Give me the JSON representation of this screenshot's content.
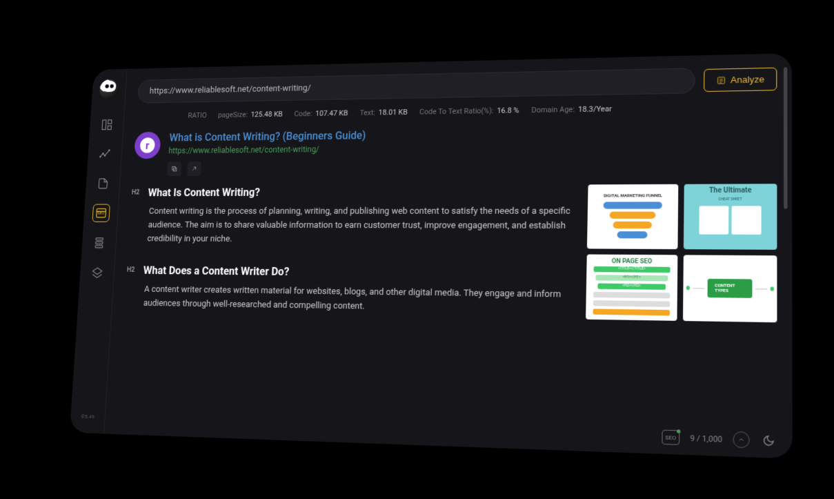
{
  "sidebar": {
    "version": "©5.49",
    "items": [
      {
        "name": "dashboard-icon"
      },
      {
        "name": "analytics-icon"
      },
      {
        "name": "pages-icon"
      },
      {
        "name": "seo-icon",
        "active": true,
        "label": "SEO"
      },
      {
        "name": "layers-icon"
      },
      {
        "name": "shape-icon"
      }
    ]
  },
  "header": {
    "url_value": "https://www.reliablesoft.net/content-writing/",
    "analyze_label": "Analyze"
  },
  "stats": {
    "ratio_label": "RATIO",
    "pagesize_label": "pageSize:",
    "pagesize_value": "125.48 KB",
    "code_label": "Code:",
    "code_value": "107.47 KB",
    "text_label": "Text:",
    "text_value": "18.01 KB",
    "cttr_label": "Code To Text Ratio(%):",
    "cttr_value": "16.8 %",
    "domain_age_label": "Domain Age:",
    "domain_age_value": "18.3/Year"
  },
  "result": {
    "title": "What is Content Writing? (Beginners Guide)",
    "url": "https://www.reliablesoft.net/content-writing/"
  },
  "headings": [
    {
      "tag": "H2",
      "title": "What Is Content Writing?",
      "desc": "Content writing is the process of planning, writing, and publishing web content to satisfy the needs of a specific audience. The aim is to share valuable information to earn customer trust, improve engagement, and establish credibility in your niche."
    },
    {
      "tag": "H2",
      "title": "What Does a Content Writer Do?",
      "desc": "A content writer creates written material for websites, blogs, and other digital media. They engage and inform audiences through well-researched and compelling content."
    }
  ],
  "thumbnails": {
    "t1_title": "DIGITAL MARKETING FUNNEL",
    "t2_title": "The Ultimate",
    "t2_subtitle": "CHEAT SHEET",
    "t3_title": "ON PAGE SEO",
    "t3_line1": "<TITLE></TITLE>",
    "t3_line2": "<H1></H1>",
    "t3_line3": "<H2></H2>",
    "t4_title": "CONTENT TYPES"
  },
  "footer": {
    "seo_label": "SEO",
    "counter": "9 / 1,000"
  }
}
